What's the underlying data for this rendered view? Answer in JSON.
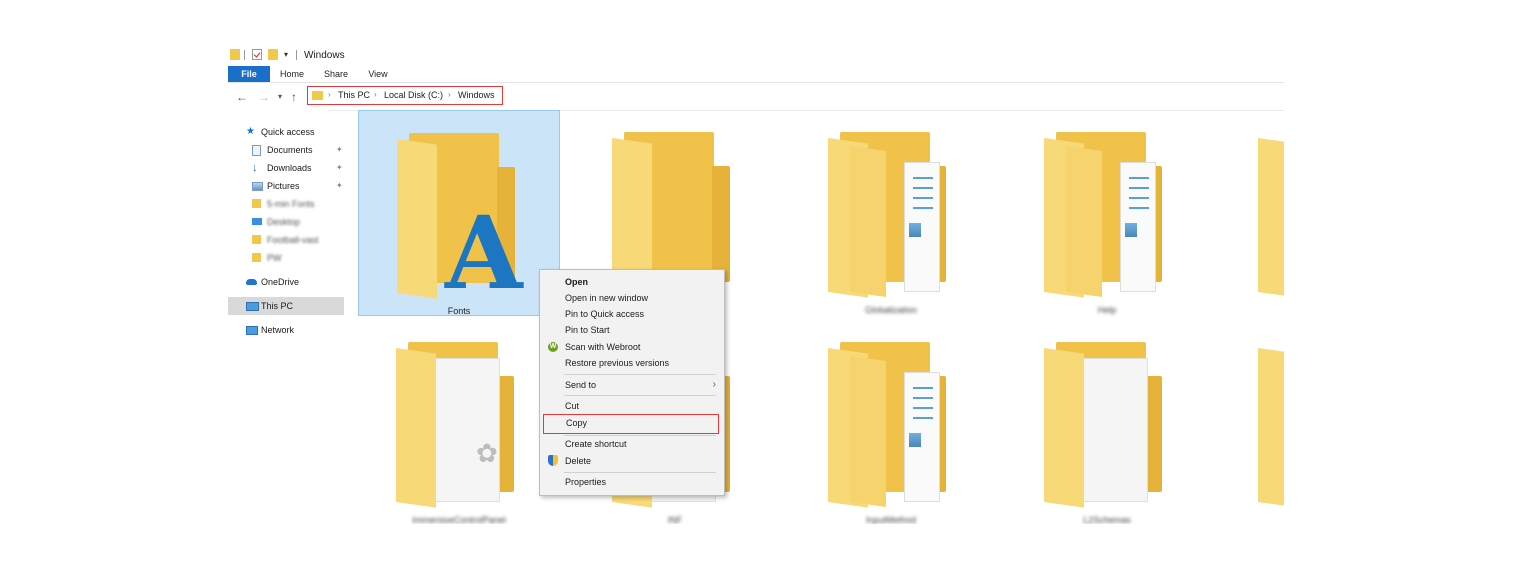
{
  "window": {
    "title": "Windows"
  },
  "ribbon": {
    "tabs": [
      "File",
      "Home",
      "Share",
      "View"
    ]
  },
  "address": {
    "crumbs": [
      "This PC",
      "Local Disk (C:)",
      "Windows"
    ]
  },
  "sidebar": {
    "items": [
      {
        "label": "Quick access",
        "icon": "star-icon"
      },
      {
        "label": "Documents",
        "icon": "documents-icon"
      },
      {
        "label": "Downloads",
        "icon": "download-icon"
      },
      {
        "label": "Pictures",
        "icon": "pictures-icon"
      },
      {
        "label": "5-min Fonts",
        "icon": "folder-icon"
      },
      {
        "label": "Desktop",
        "icon": "desktop-icon"
      },
      {
        "label": "Football-vast",
        "icon": "folder-icon"
      },
      {
        "label": "PW",
        "icon": "folder-icon"
      },
      {
        "label": "OneDrive",
        "icon": "cloud-icon"
      },
      {
        "label": "This PC",
        "icon": "pc-icon"
      },
      {
        "label": "Network",
        "icon": "network-icon"
      }
    ]
  },
  "content": {
    "folders": [
      {
        "label": "Fonts"
      },
      {
        "label": ""
      },
      {
        "label": "Globalization"
      },
      {
        "label": "Help"
      },
      {
        "label": "ImmersiveControlPanel"
      },
      {
        "label": "INF"
      },
      {
        "label": "InputMethod"
      },
      {
        "label": "L2Schemas"
      }
    ]
  },
  "context_menu": {
    "items": [
      "Open",
      "Open in new window",
      "Pin to Quick access",
      "Pin to Start",
      "Scan with Webroot",
      "Restore previous versions",
      "Send to",
      "Cut",
      "Copy",
      "Create shortcut",
      "Delete",
      "Properties"
    ]
  },
  "colors": {
    "accent": "#1a6fc9",
    "highlight": "#e2393b",
    "selection": "#cce4f7",
    "folder": "#f0c24a"
  }
}
